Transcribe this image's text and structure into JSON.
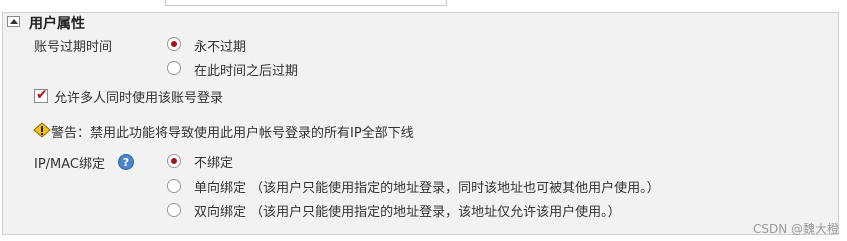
{
  "section": {
    "title": "用户属性"
  },
  "expiry": {
    "label": "账号过期时间",
    "options": [
      {
        "label": "永不过期",
        "checked": true
      },
      {
        "label": "在此时间之后过期",
        "checked": false
      }
    ]
  },
  "multi_login": {
    "label": "允许多人同时使用该账号登录",
    "checked": true
  },
  "warning": {
    "text": "警告：禁用此功能将导致使用此用户帐号登录的所有IP全部下线"
  },
  "binding": {
    "label": "IP/MAC绑定",
    "help": "?",
    "options": [
      {
        "label": "不绑定",
        "checked": true
      },
      {
        "label": "单向绑定 （该用户只能使用指定的地址登录，同时该地址也可被其他用户使用。）",
        "checked": false
      },
      {
        "label": "双向绑定 （该用户只能使用指定的地址登录，该地址仅允许该用户使用。）",
        "checked": false
      }
    ]
  },
  "watermark": "CSDN @魏大橙"
}
